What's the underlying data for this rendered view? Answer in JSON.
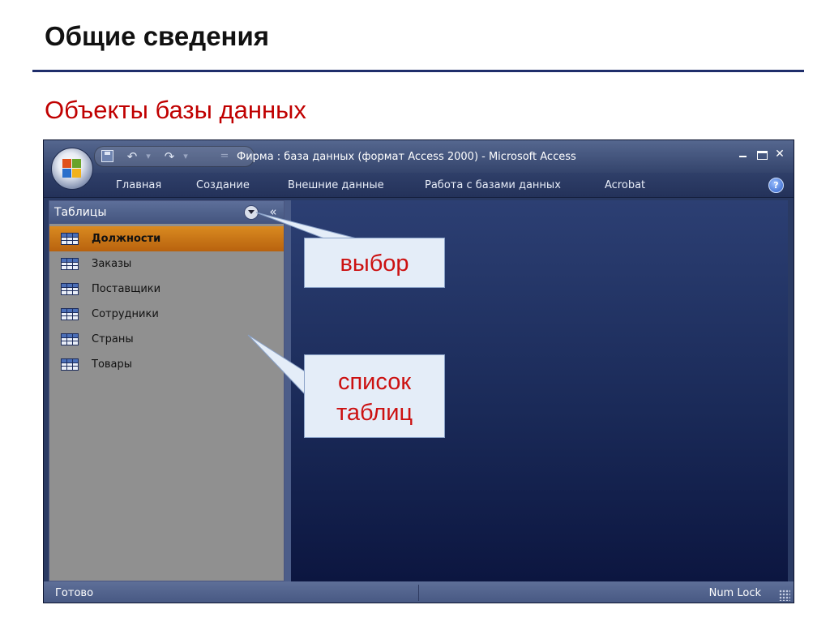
{
  "slide": {
    "title": "Общие сведения",
    "subtitle": "Объекты базы данных"
  },
  "window": {
    "title": "Фирма : база данных (формат Access 2000) - Microsoft Access",
    "qat": {
      "undo_icon": "↶",
      "redo_icon": "↷",
      "dropdown_glyph": "▾",
      "customize_glyph": "="
    },
    "controls": {
      "close": "✕"
    }
  },
  "ribbon": {
    "tabs": [
      "Главная",
      "Создание",
      "Внешние данные",
      "Работа с базами данных",
      "Acrobat"
    ],
    "help_glyph": "?"
  },
  "nav_pane": {
    "header": "Таблицы",
    "collapse_glyph": "«",
    "items": [
      {
        "label": "Должности",
        "selected": true
      },
      {
        "label": "Заказы",
        "selected": false
      },
      {
        "label": "Поставщики",
        "selected": false
      },
      {
        "label": "Сотрудники",
        "selected": false
      },
      {
        "label": "Страны",
        "selected": false
      },
      {
        "label": "Товары",
        "selected": false
      }
    ]
  },
  "statusbar": {
    "status": "Готово",
    "indicator": "Num Lock"
  },
  "callouts": {
    "selector": "выбор",
    "table_list_line1": "список",
    "table_list_line2": "таблиц"
  },
  "colors": {
    "title_rule": "#1f2e6b",
    "subtitle": "#c00000",
    "callout_text": "#cc1111",
    "selected_item": "#c8701a",
    "workspace": "#1a2a58"
  }
}
